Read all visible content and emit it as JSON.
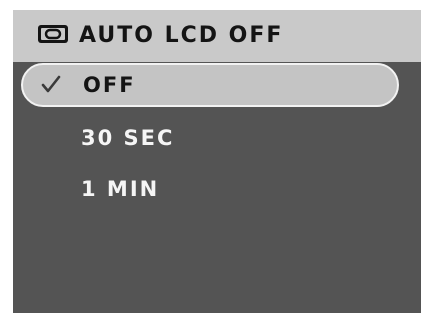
{
  "header": {
    "icon": "lcd-screen-icon",
    "title": "AUTO LCD OFF"
  },
  "menu": {
    "items": [
      {
        "label": "OFF",
        "selected": true,
        "icon": "checkmark-icon"
      },
      {
        "label": "30 SEC",
        "selected": false
      },
      {
        "label": "1 MIN",
        "selected": false
      }
    ]
  },
  "colors": {
    "background": "#545454",
    "header": "#c9c9c9",
    "highlight": "#c4c4c4",
    "highlight_border": "#f2f2f2",
    "text_light": "#f5f5f5",
    "text_dark": "#141414"
  }
}
